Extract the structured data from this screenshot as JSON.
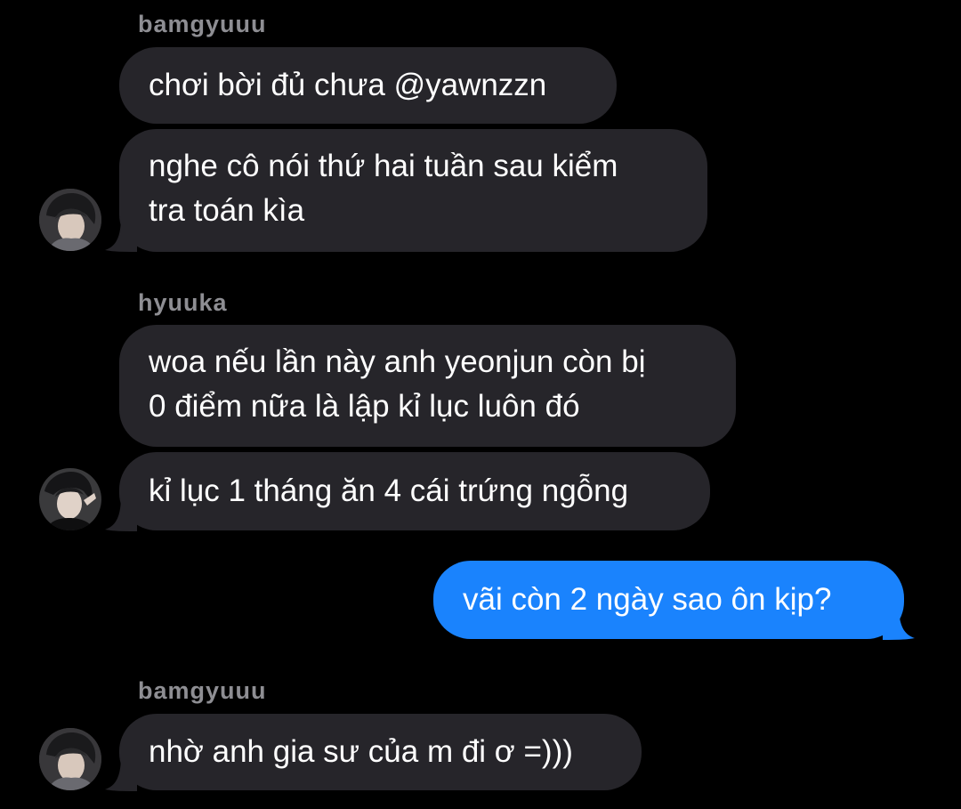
{
  "colors": {
    "background": "#000000",
    "incoming_bubble": "#26252a",
    "outgoing_bubble": "#1a83fd",
    "sender_name": "#8e8e93",
    "text": "#ffffff"
  },
  "messages": [
    {
      "sender": "bamgyuuu",
      "direction": "incoming",
      "text": "chơi bời đủ chưa @yawnzzn"
    },
    {
      "direction": "incoming",
      "lines": [
        "nghe cô nói thứ hai tuần sau kiểm",
        "tra toán kìa"
      ]
    },
    {
      "sender": "hyuuka",
      "direction": "incoming",
      "lines": [
        "woa nếu lần này anh yeonjun còn bị",
        "0 điểm nữa là lập kỉ lục luôn đó"
      ]
    },
    {
      "direction": "incoming",
      "text": "kỉ lục 1 tháng ăn 4 cái trứng ngỗng"
    },
    {
      "direction": "outgoing",
      "text": "vãi còn 2 ngày sao ôn kịp?"
    },
    {
      "sender": "bamgyuuu",
      "direction": "incoming",
      "text": "nhờ anh gia sư của m đi ơ =)))"
    }
  ],
  "avatars": [
    "avatar-bamgyuuu",
    "avatar-hyuuka",
    "avatar-bamgyuuu"
  ]
}
